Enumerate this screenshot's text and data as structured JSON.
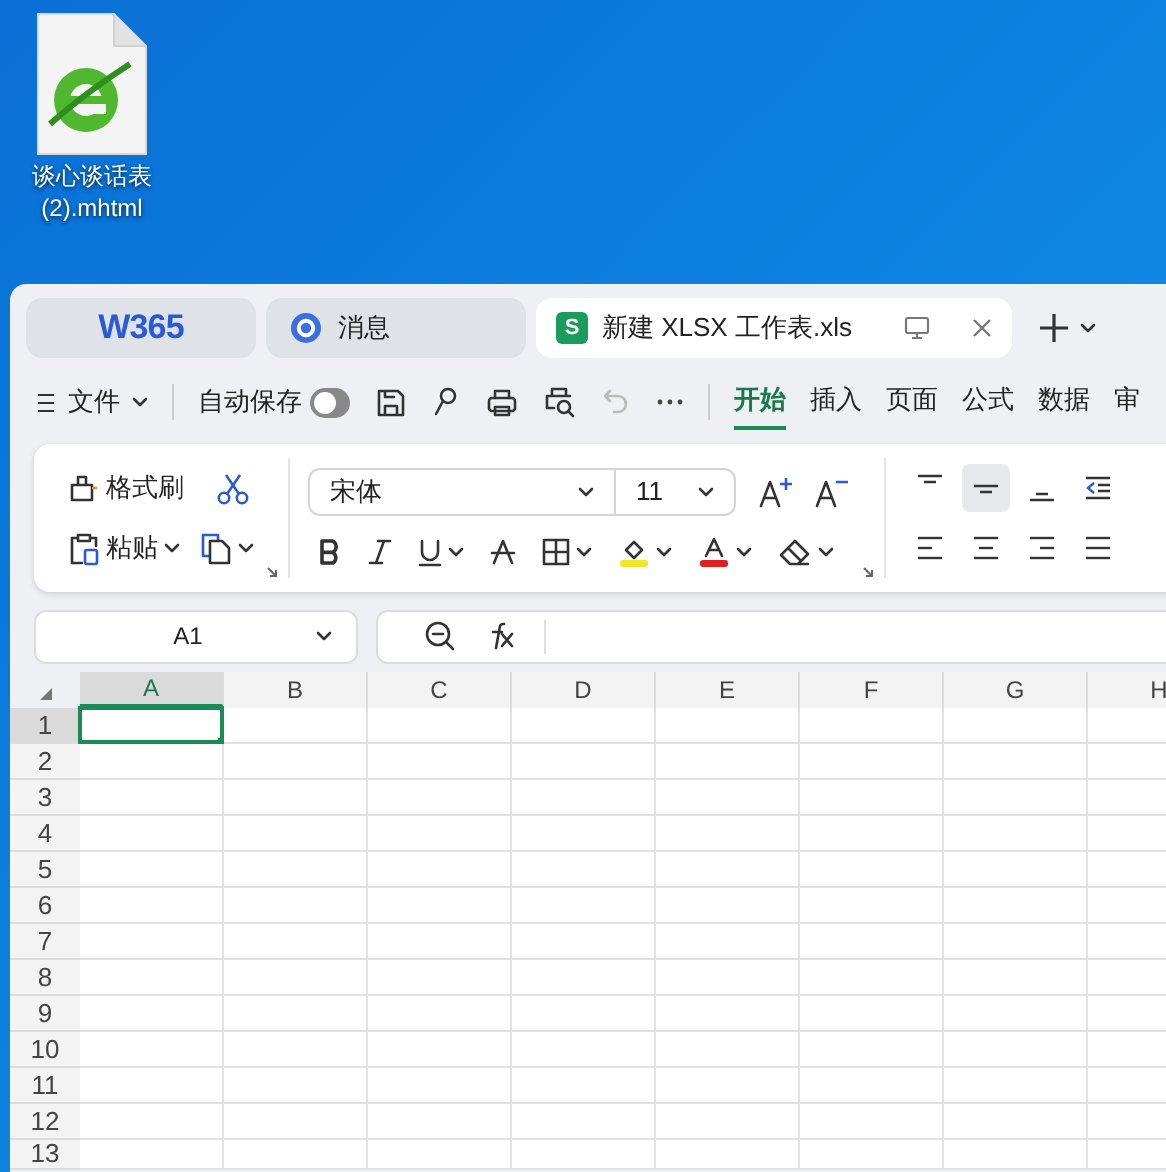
{
  "desktop_icon": {
    "label_lines": [
      "谈心谈话表",
      "(2).mhtml"
    ]
  },
  "tabs": [
    {
      "kind": "home",
      "label": "W365",
      "selected": false
    },
    {
      "kind": "messages",
      "label": "消息",
      "selected": false
    },
    {
      "kind": "document",
      "badge": "S",
      "label": "新建 XLSX 工作表.xls",
      "selected": true
    }
  ],
  "toolbar": {
    "file_menu": "文件",
    "autosave": {
      "label": "自动保存",
      "on": false
    },
    "ribbon_tabs": [
      {
        "label": "开始",
        "selected": true
      },
      {
        "label": "插入",
        "selected": false
      },
      {
        "label": "页面",
        "selected": false
      },
      {
        "label": "公式",
        "selected": false
      },
      {
        "label": "数据",
        "selected": false
      },
      {
        "label": "审",
        "selected": false
      }
    ]
  },
  "ribbon": {
    "format_painter": "格式刷",
    "paste": "粘贴",
    "font_name": "宋体",
    "font_size": "11"
  },
  "formula_bar": {
    "name_box": "A1"
  },
  "grid": {
    "columns": [
      {
        "label": "A",
        "selected": true
      },
      {
        "label": "B",
        "selected": false
      },
      {
        "label": "C",
        "selected": false
      },
      {
        "label": "D",
        "selected": false
      },
      {
        "label": "E",
        "selected": false
      },
      {
        "label": "F",
        "selected": false
      },
      {
        "label": "G",
        "selected": false
      },
      {
        "label": "H",
        "selected": false
      }
    ],
    "rows": [
      {
        "label": "1",
        "selected": true
      },
      {
        "label": "2",
        "selected": false
      },
      {
        "label": "3",
        "selected": false
      },
      {
        "label": "4",
        "selected": false
      },
      {
        "label": "5",
        "selected": false
      },
      {
        "label": "6",
        "selected": false
      },
      {
        "label": "7",
        "selected": false
      },
      {
        "label": "8",
        "selected": false
      },
      {
        "label": "9",
        "selected": false
      },
      {
        "label": "10",
        "selected": false
      },
      {
        "label": "11",
        "selected": false
      },
      {
        "label": "12",
        "selected": false
      },
      {
        "label": "13",
        "selected": false
      }
    ]
  }
}
